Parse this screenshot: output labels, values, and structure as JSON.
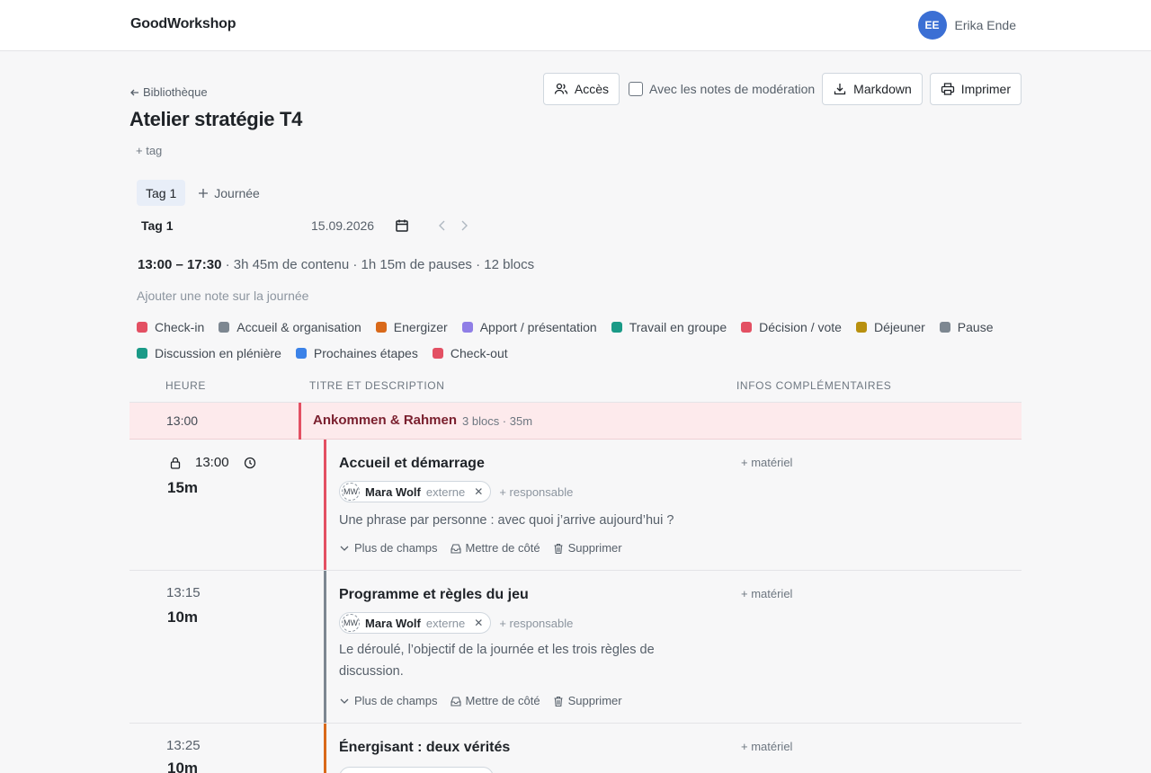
{
  "app": {
    "brand": "GoodWorkshop"
  },
  "user": {
    "initials": "EE",
    "name": "Erika Ende",
    "avatar_color": "#3b6fd4"
  },
  "header": {
    "back_label": "Bibliothèque",
    "title": "Atelier stratégie T4",
    "add_tag": "+ tag"
  },
  "toolbar": {
    "access_label": "Accès",
    "moderation_label": "Avec les notes de modération",
    "markdown_label": "Markdown",
    "print_label": "Imprimer"
  },
  "days": {
    "tabs": [
      {
        "label": "Tag 1"
      }
    ],
    "add_label": "Journée",
    "current_name": "Tag 1",
    "current_date": "15.09.2026"
  },
  "summary": {
    "range": "13:00 – 17:30",
    "details": " · 3h 45m de contenu · 1h 15m de pauses · 12 blocs"
  },
  "day_note_placeholder": "Ajouter une note sur la journée",
  "legend": [
    {
      "label": "Check-in",
      "color": "#e35063"
    },
    {
      "label": "Accueil & organisation",
      "color": "#7d8791"
    },
    {
      "label": "Energizer",
      "color": "#d9691a"
    },
    {
      "label": "Apport / présentation",
      "color": "#8f7ee6"
    },
    {
      "label": "Travail en groupe",
      "color": "#1a9a87"
    },
    {
      "label": "Décision / vote",
      "color": "#e35063"
    },
    {
      "label": "Déjeuner",
      "color": "#b8900f"
    },
    {
      "label": "Pause",
      "color": "#7d8791"
    },
    {
      "label": "Discussion en plénière",
      "color": "#1a9a87"
    },
    {
      "label": "Prochaines étapes",
      "color": "#3b82e8"
    },
    {
      "label": "Check-out",
      "color": "#e35063"
    }
  ],
  "table": {
    "col_time": "HEURE",
    "col_title": "TITRE ET DESCRIPTION",
    "col_info": "INFOS COMPLÉMENTAIRES"
  },
  "section": {
    "time": "13:00",
    "title": "Ankommen & Rahmen",
    "meta": "3 blocs · 35m",
    "color": "#e35063"
  },
  "blocks": [
    {
      "time": "13:00",
      "duration": "15m",
      "title": "Accueil et démarrage",
      "person_initials": "MW",
      "person_name": "Mara Wolf",
      "person_role": "externe",
      "add_responsible": "+ responsable",
      "description": "Une phrase par personne : avec quoi j’arrive aujourd’hui ?",
      "add_material": "+ matériel",
      "more_fields": "Plus de champs",
      "set_aside": "Mettre de côté",
      "delete": "Supprimer",
      "color": "#e35063"
    },
    {
      "time": "13:15",
      "duration": "10m",
      "title": "Programme et règles du jeu",
      "person_initials": "MW",
      "person_name": "Mara Wolf",
      "person_role": "externe",
      "add_responsible": "+ responsable",
      "description": "Le déroulé, l’objectif de la journée et les trois règles de discussion.",
      "add_material": "+ matériel",
      "more_fields": "Plus de champs",
      "set_aside": "Mettre de côté",
      "delete": "Supprimer",
      "color": "#7d8791"
    },
    {
      "time": "13:25",
      "duration": "10m",
      "title": "Énergisant : deux vérités",
      "add_material": "+ matériel",
      "color": "#d9691a"
    }
  ]
}
